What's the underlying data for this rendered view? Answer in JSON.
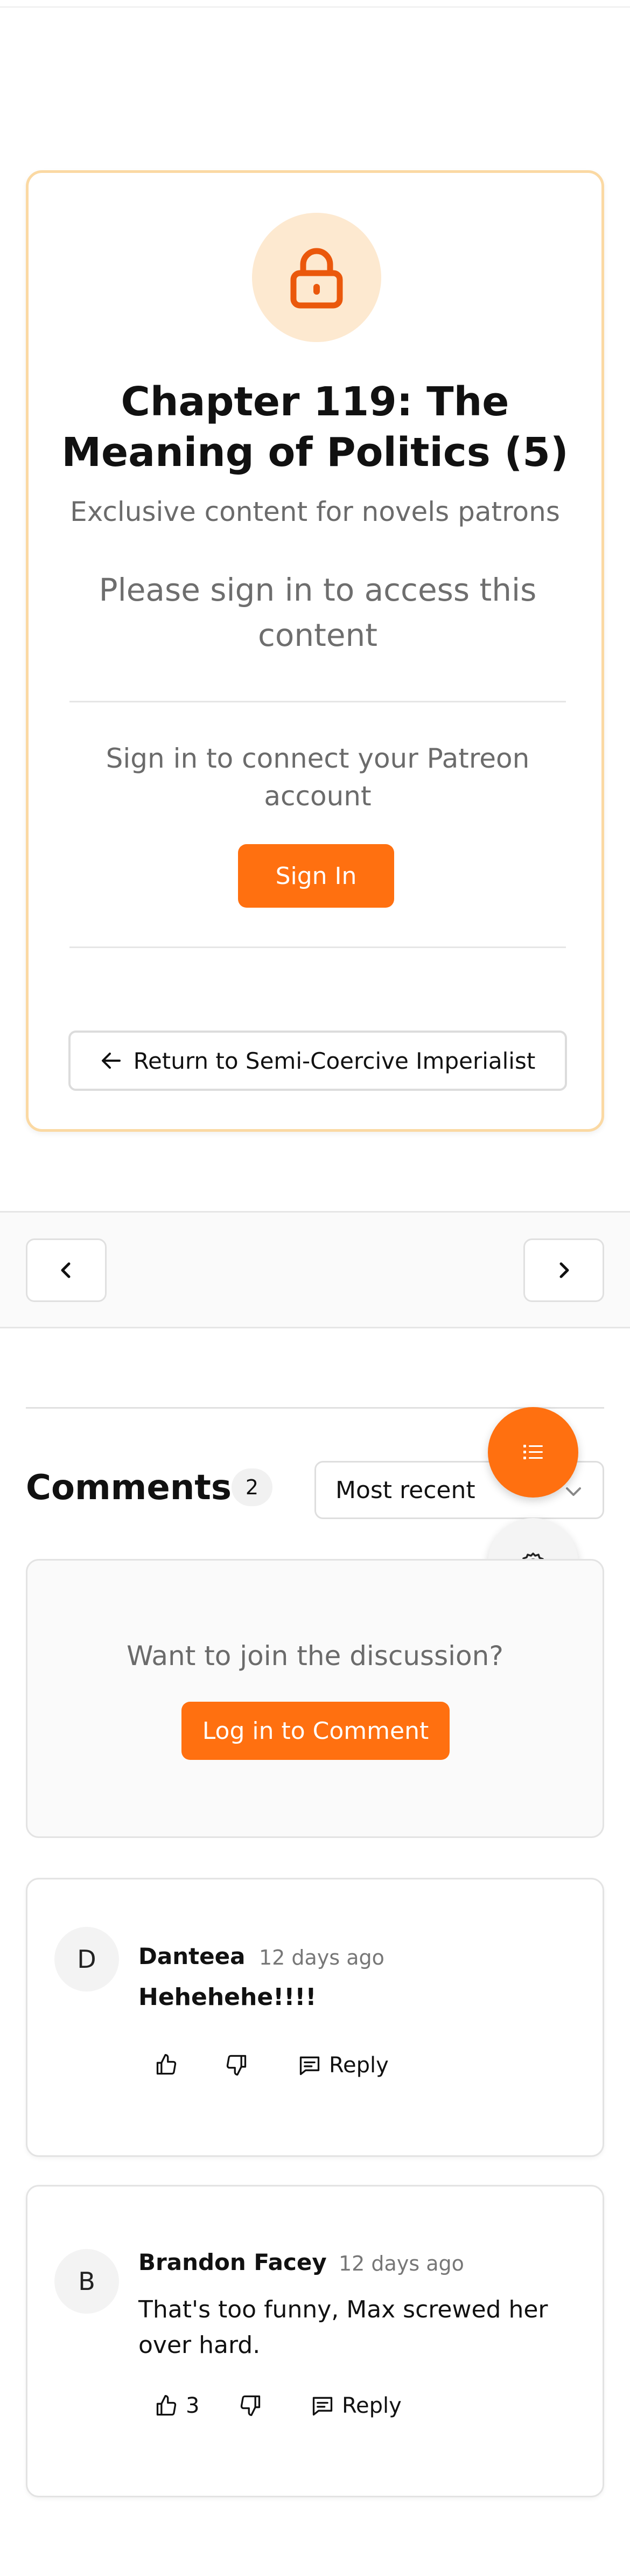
{
  "chapter": {
    "title": "Chapter 119: The Meaning of Politics (5)",
    "subtitle": "Exclusive content for novels patrons",
    "lock_icon": "lock-icon",
    "signin_message": "Please sign in to access this content",
    "connect_message": "Sign in to connect your Patreon account",
    "signin_label": "Sign In",
    "return_label": "Return to Semi-Coercive Imperialist"
  },
  "navigation": {
    "prev_icon": "chevron-left-icon",
    "next_icon": "chevron-right-icon"
  },
  "comments": {
    "title": "Comments",
    "count": "2",
    "sort_selected": "Most recent",
    "join_text": "Want to join the discussion?",
    "login_label": "Log in to Comment",
    "items": [
      {
        "initial": "D",
        "author": "Danteea",
        "time": "12 days ago",
        "text": "Hehehehe!!!!",
        "likes": "",
        "reply_label": "Reply"
      },
      {
        "initial": "B",
        "author": "Brandon Facey",
        "time": "12 days ago",
        "text": "That's too funny, Max screwed her over hard.",
        "likes": "3",
        "reply_label": "Reply"
      }
    ]
  },
  "colors": {
    "accent": "#ff7010",
    "card_border": "#fbd9a3",
    "lock_bg": "#fde9d0"
  }
}
